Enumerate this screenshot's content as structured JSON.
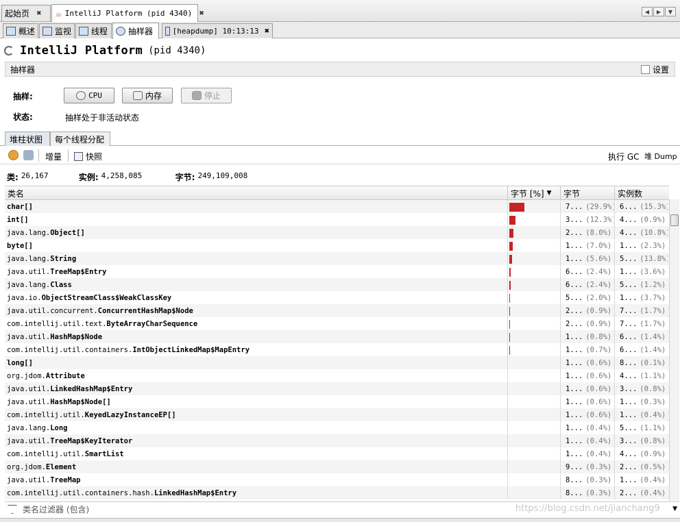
{
  "doc_tabs": [
    {
      "label": "起始页"
    },
    {
      "label": "IntelliJ Platform (pid 4340)"
    }
  ],
  "sub_tabs": [
    {
      "label": "概述"
    },
    {
      "label": "监视"
    },
    {
      "label": "线程"
    },
    {
      "label": "抽样器"
    },
    {
      "label": "[heapdump] 10:13:13"
    }
  ],
  "page": {
    "app_name": "IntelliJ Platform",
    "pid": "(pid 4340)"
  },
  "section": {
    "title": "抽样器",
    "settings_label": "设置"
  },
  "sampling": {
    "label": "抽样:",
    "cpu": "CPU",
    "memory": "内存",
    "stop": "停止",
    "status_label": "状态:",
    "status_value": "抽样处于非活动状态"
  },
  "inner_tabs": [
    {
      "label": "堆柱状图"
    },
    {
      "label": "每个线程分配"
    }
  ],
  "toolbar": {
    "delta": "增量",
    "snapshot": "快照",
    "gc": "执行 GC",
    "heapdump": "堆 Dump"
  },
  "stats": {
    "classes_label": "类:",
    "classes": "26,167",
    "instances_label": "实例:",
    "instances": "4,258,085",
    "bytes_label": "字节:",
    "bytes": "249,109,008"
  },
  "table": {
    "headers": [
      "类名",
      "字节 [%]",
      "字节",
      "实例数"
    ],
    "rows": [
      {
        "pkg": "",
        "cls": "char[]",
        "pct": 29.9,
        "bytes": "7...",
        "bp": "(29.9%)",
        "inst": "6...",
        "ip": "(15.3%)"
      },
      {
        "pkg": "",
        "cls": "int[]",
        "pct": 12.3,
        "bytes": "3...",
        "bp": "(12.3%)",
        "inst": "4...",
        "ip": "(0.9%)"
      },
      {
        "pkg": "java.lang.",
        "cls": "Object[]",
        "pct": 8.0,
        "bytes": "2...",
        "bp": "(8.0%)",
        "inst": "4...",
        "ip": "(10.8%)"
      },
      {
        "pkg": "",
        "cls": "byte[]",
        "pct": 7.0,
        "bytes": "1...",
        "bp": "(7.0%)",
        "inst": "1...",
        "ip": "(2.3%)"
      },
      {
        "pkg": "java.lang.",
        "cls": "String",
        "pct": 5.6,
        "bytes": "1...",
        "bp": "(5.6%)",
        "inst": "5...",
        "ip": "(13.8%)"
      },
      {
        "pkg": "java.util.",
        "cls": "TreeMap$Entry",
        "pct": 2.4,
        "bytes": "6...",
        "bp": "(2.4%)",
        "inst": "1...",
        "ip": "(3.6%)"
      },
      {
        "pkg": "java.lang.",
        "cls": "Class",
        "pct": 2.4,
        "bytes": "6...",
        "bp": "(2.4%)",
        "inst": "5...",
        "ip": "(1.2%)"
      },
      {
        "pkg": "java.io.",
        "cls": "ObjectStreamClass$WeakClassKey",
        "pct": 2.0,
        "bytes": "5...",
        "bp": "(2.0%)",
        "inst": "1...",
        "ip": "(3.7%)"
      },
      {
        "pkg": "java.util.concurrent.",
        "cls": "ConcurrentHashMap$Node",
        "pct": 0.9,
        "bytes": "2...",
        "bp": "(0.9%)",
        "inst": "7...",
        "ip": "(1.7%)"
      },
      {
        "pkg": "com.intellij.util.text.",
        "cls": "ByteArrayCharSequence",
        "pct": 0.9,
        "bytes": "2...",
        "bp": "(0.9%)",
        "inst": "7...",
        "ip": "(1.7%)"
      },
      {
        "pkg": "java.util.",
        "cls": "HashMap$Node",
        "pct": 0.8,
        "bytes": "1...",
        "bp": "(0.8%)",
        "inst": "6...",
        "ip": "(1.4%)"
      },
      {
        "pkg": "com.intellij.util.containers.",
        "cls": "IntObjectLinkedMap$MapEntry",
        "pct": 0.7,
        "bytes": "1...",
        "bp": "(0.7%)",
        "inst": "6...",
        "ip": "(1.4%)"
      },
      {
        "pkg": "",
        "cls": "long[]",
        "pct": 0.6,
        "bytes": "1...",
        "bp": "(0.6%)",
        "inst": "8...",
        "ip": "(0.1%)"
      },
      {
        "pkg": "org.jdom.",
        "cls": "Attribute",
        "pct": 0.6,
        "bytes": "1...",
        "bp": "(0.6%)",
        "inst": "4...",
        "ip": "(1.1%)"
      },
      {
        "pkg": "java.util.",
        "cls": "LinkedHashMap$Entry",
        "pct": 0.6,
        "bytes": "1...",
        "bp": "(0.6%)",
        "inst": "3...",
        "ip": "(0.8%)"
      },
      {
        "pkg": "java.util.",
        "cls": "HashMap$Node[]",
        "pct": 0.6,
        "bytes": "1...",
        "bp": "(0.6%)",
        "inst": "1...",
        "ip": "(0.3%)"
      },
      {
        "pkg": "com.intellij.util.",
        "cls": "KeyedLazyInstanceEP[]",
        "pct": 0.6,
        "bytes": "1...",
        "bp": "(0.6%)",
        "inst": "1...",
        "ip": "(0.4%)"
      },
      {
        "pkg": "java.lang.",
        "cls": "Long",
        "pct": 0.4,
        "bytes": "1...",
        "bp": "(0.4%)",
        "inst": "5...",
        "ip": "(1.1%)"
      },
      {
        "pkg": "java.util.",
        "cls": "TreeMap$KeyIterator",
        "pct": 0.4,
        "bytes": "1...",
        "bp": "(0.4%)",
        "inst": "3...",
        "ip": "(0.8%)"
      },
      {
        "pkg": "com.intellij.util.",
        "cls": "SmartList",
        "pct": 0.4,
        "bytes": "1...",
        "bp": "(0.4%)",
        "inst": "4...",
        "ip": "(0.9%)"
      },
      {
        "pkg": "org.jdom.",
        "cls": "Element",
        "pct": 0.3,
        "bytes": "9...",
        "bp": "(0.3%)",
        "inst": "2...",
        "ip": "(0.5%)"
      },
      {
        "pkg": "java.util.",
        "cls": "TreeMap",
        "pct": 0.3,
        "bytes": "8...",
        "bp": "(0.3%)",
        "inst": "1...",
        "ip": "(0.4%)"
      },
      {
        "pkg": "com.intellij.util.containers.hash.",
        "cls": "LinkedHashMap$Entry",
        "pct": 0.3,
        "bytes": "8...",
        "bp": "(0.3%)",
        "inst": "2...",
        "ip": "(0.4%)"
      }
    ]
  },
  "filter": {
    "placeholder": "类名过滤器 (包含)"
  },
  "watermark": "https://blog.csdn.net/jianchang9",
  "colors": {
    "bar": "#c62525"
  }
}
